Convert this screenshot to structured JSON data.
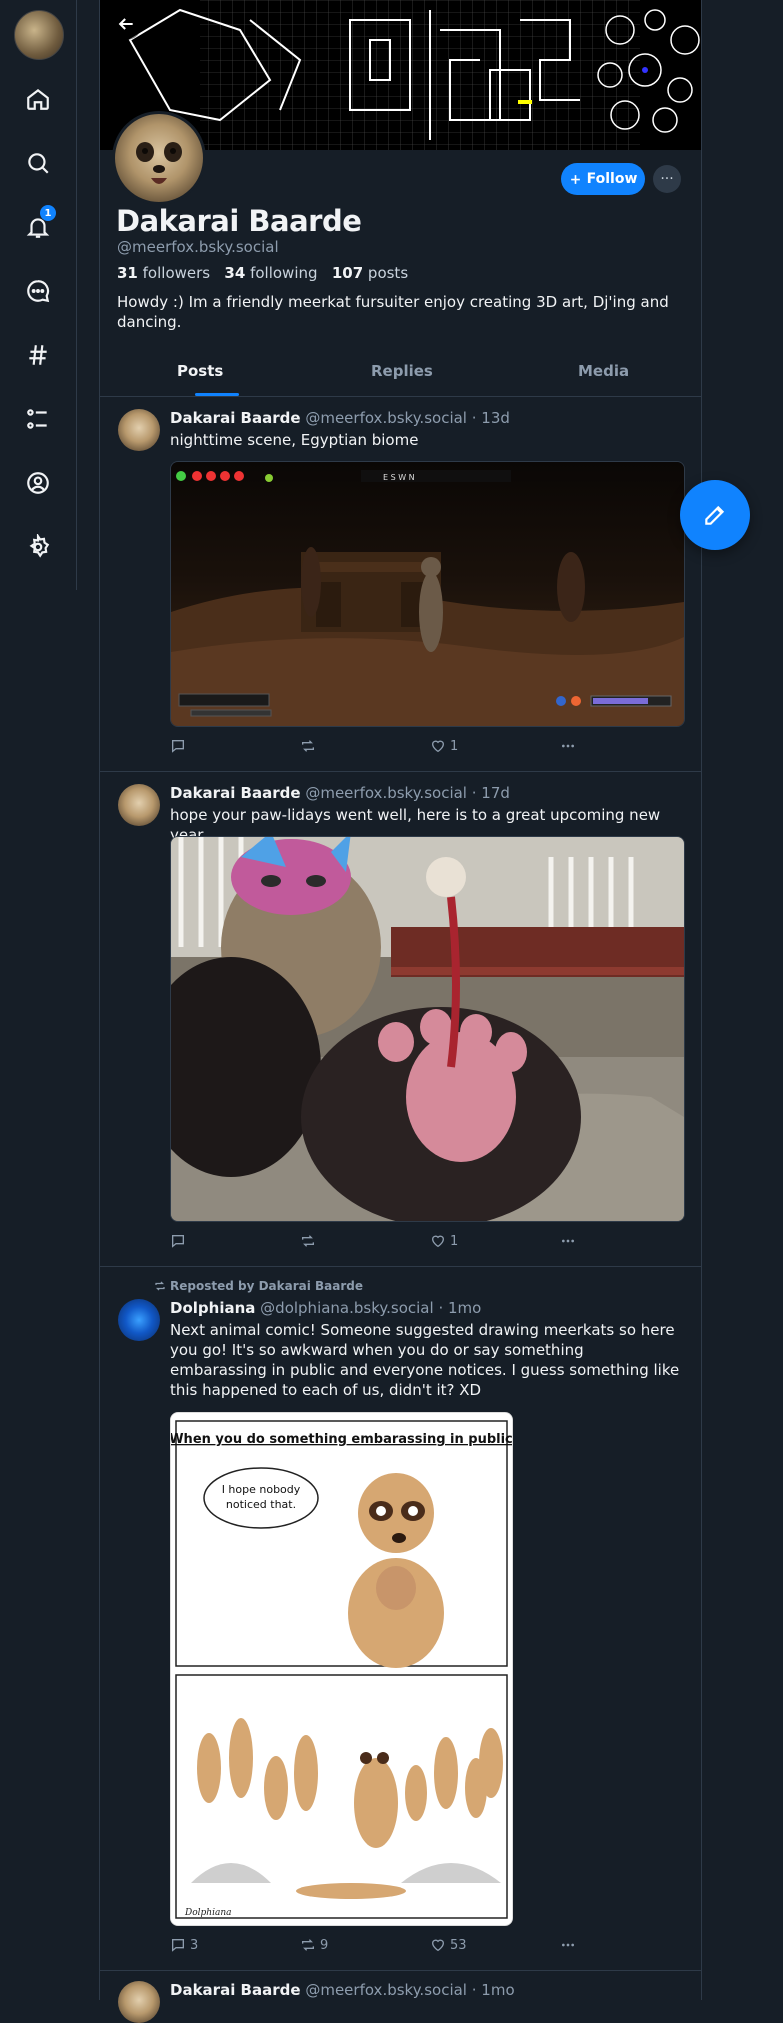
{
  "sidebar": {
    "notifications_badge": "1",
    "items": [
      {
        "name": "home-icon"
      },
      {
        "name": "search-icon"
      },
      {
        "name": "notifications-icon"
      },
      {
        "name": "chat-icon"
      },
      {
        "name": "hashtag-icon"
      },
      {
        "name": "lists-icon"
      },
      {
        "name": "profile-icon"
      },
      {
        "name": "settings-icon"
      }
    ]
  },
  "profile": {
    "display_name": "Dakarai Baarde",
    "handle": "@meerfox.bsky.social",
    "followers_count": "31",
    "followers_label": "followers",
    "following_count": "34",
    "following_label": "following",
    "posts_count": "107",
    "posts_label": "posts",
    "bio": "Howdy :) Im a friendly meerkat fursuiter enjoy creating 3D art, Dj'ing and dancing.",
    "follow_label": "Follow",
    "more_label": "···"
  },
  "tabs": [
    {
      "label": "Posts",
      "active": true
    },
    {
      "label": "Replies",
      "active": false
    },
    {
      "label": "Media",
      "active": false
    }
  ],
  "game_hud": {
    "compass": "E   S   W   N"
  },
  "posts": [
    {
      "author": "Dakarai Baarde",
      "handle": "@meerfox.bsky.social",
      "time": "· 13d",
      "text": "nighttime scene, Egyptian biome",
      "replies": "",
      "reposts": "",
      "likes": "1"
    },
    {
      "author": "Dakarai Baarde",
      "handle": "@meerfox.bsky.social",
      "time": "· 17d",
      "text": "hope your paw-lidays went well, here is to a great upcoming new year.",
      "replies": "",
      "reposts": "",
      "likes": "1"
    },
    {
      "repost_label": "Reposted by Dakarai Baarde",
      "author": "Dolphiana",
      "handle": "@dolphiana.bsky.social",
      "time": "· 1mo",
      "text": "Next animal comic! Someone suggested drawing meerkats so here you go! It's so awkward when you do or say something embarassing in public and everyone notices. I guess something like this happened to each of us, didn't it? XD",
      "comic_title": "When you do something embarassing in public",
      "comic_bubble": "I hope nobody noticed that.",
      "comic_signature": "Dolphiana",
      "replies": "3",
      "reposts": "9",
      "likes": "53"
    },
    {
      "author": "Dakarai Baarde",
      "handle": "@meerfox.bsky.social",
      "time": "· 1mo"
    }
  ],
  "colors": {
    "background": "#161e27",
    "accent": "#1083fe",
    "border": "#2e3a48",
    "muted_text": "#8d9cad"
  }
}
